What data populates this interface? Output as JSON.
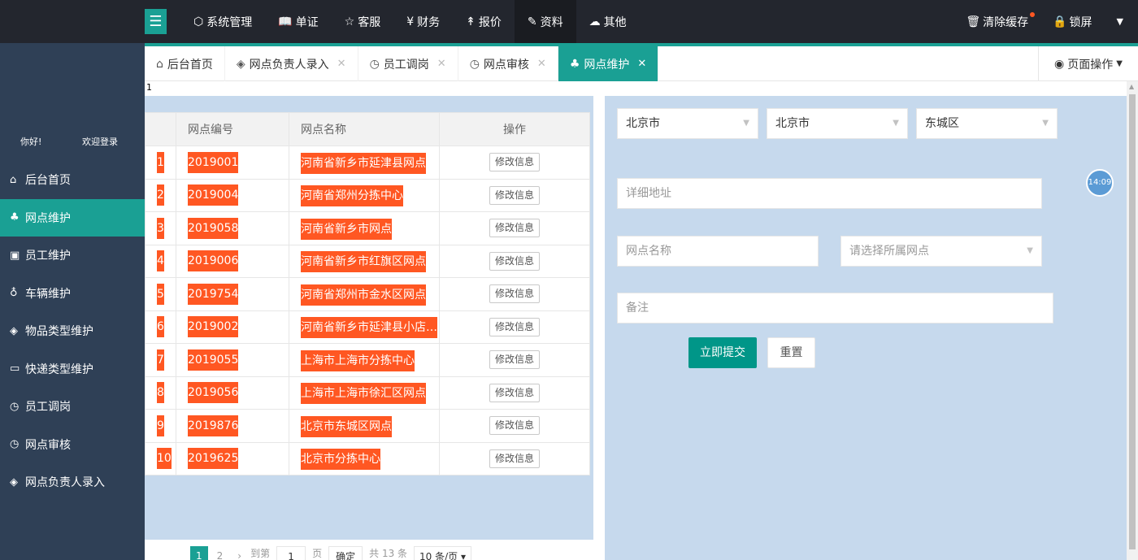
{
  "topnav": {
    "menu_icon": "hamburger-icon",
    "items": [
      {
        "label": "系统管理",
        "icon": "cube-icon"
      },
      {
        "label": "单证",
        "icon": "book-icon"
      },
      {
        "label": "客服",
        "icon": "star-icon"
      },
      {
        "label": "财务",
        "icon": "yen-icon"
      },
      {
        "label": "报价",
        "icon": "pin-icon"
      },
      {
        "label": "资料",
        "icon": "edit-icon"
      },
      {
        "label": "其他",
        "icon": "cloud-icon"
      }
    ],
    "clear_cache": "清除缓存",
    "lock_screen": "锁屏"
  },
  "sidebar": {
    "greeting": "你好!",
    "welcome": "欢迎登录",
    "items": [
      {
        "label": "后台首页",
        "icon": "home-icon"
      },
      {
        "label": "网点维护",
        "icon": "network-icon"
      },
      {
        "label": "员工维护",
        "icon": "id-card-icon"
      },
      {
        "label": "车辆维护",
        "icon": "vehicle-icon"
      },
      {
        "label": "物品类型维护",
        "icon": "code-icon"
      },
      {
        "label": "快递类型维护",
        "icon": "window-icon"
      },
      {
        "label": "员工调岗",
        "icon": "clock-icon"
      },
      {
        "label": "网点审核",
        "icon": "clock-icon"
      },
      {
        "label": "网点负责人录入",
        "icon": "code-icon"
      }
    ]
  },
  "tabs": [
    {
      "label": "后台首页"
    },
    {
      "label": "网点负责人录入"
    },
    {
      "label": "员工调岗"
    },
    {
      "label": "网点审核"
    },
    {
      "label": "网点维护"
    }
  ],
  "page_ops": "页面操作",
  "content_marker": "1",
  "table": {
    "headers": [
      "网点编号",
      "网点名称",
      "操作"
    ],
    "edit_label": "修改信息",
    "rows": [
      {
        "n": "1",
        "code": "2019001",
        "name": "河南省新乡市延津县网点"
      },
      {
        "n": "2",
        "code": "2019004",
        "name": "河南省郑州分拣中心"
      },
      {
        "n": "3",
        "code": "2019058",
        "name": "河南省新乡市网点"
      },
      {
        "n": "4",
        "code": "2019006",
        "name": "河南省新乡市红旗区网点"
      },
      {
        "n": "5",
        "code": "2019754",
        "name": "河南省郑州市金水区网点"
      },
      {
        "n": "6",
        "code": "2019002",
        "name": "河南省新乡市延津县小店…"
      },
      {
        "n": "7",
        "code": "2019055",
        "name": "上海市上海市分拣中心"
      },
      {
        "n": "8",
        "code": "2019056",
        "name": "上海市上海市徐汇区网点"
      },
      {
        "n": "9",
        "code": "2019876",
        "name": "北京市东城区网点"
      },
      {
        "n": "10",
        "code": "2019625",
        "name": "北京市分拣中心"
      }
    ]
  },
  "pager": {
    "current": "1",
    "next_page": "2",
    "goto": "到第",
    "page_input": "1",
    "page_unit": "页",
    "confirm": "确定",
    "total": "共 13 条",
    "page_size": "10 条/页"
  },
  "form": {
    "province": "北京市",
    "city": "北京市",
    "district": "东城区",
    "address_placeholder": "详细地址",
    "name_placeholder": "网点名称",
    "parent_placeholder": "请选择所属网点",
    "remark_placeholder": "备注",
    "submit": "立即提交",
    "reset": "重置"
  },
  "clock_time": "14:09",
  "colors": {
    "accent": "#1aa094",
    "highlight": "#ff5722",
    "topbar": "#23262e",
    "sidebar": "#2f4056",
    "panel": "#c6d9ed"
  }
}
